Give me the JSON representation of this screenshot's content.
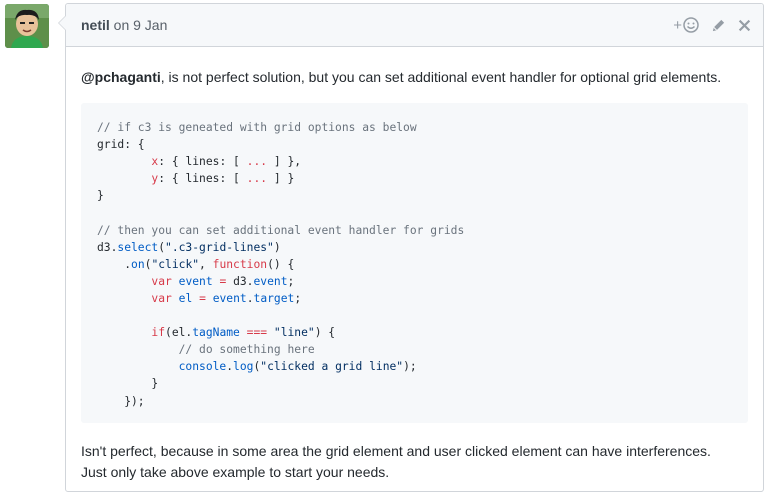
{
  "comment": {
    "author": "netil",
    "date_text": "on 9 Jan",
    "mention": "@pchaganti",
    "intro_text": ", is not perfect solution, but you can set additional event handler for optional grid elements.",
    "code_lines": [
      "// if c3 is geneated with grid options as below",
      "grid: {",
      "        x: { lines: [ ... ] },",
      "        y: { lines: [ ... ] }",
      "}",
      "",
      "// then you can set additional event handler for grids",
      "d3.select(\".c3-grid-lines\")",
      "    .on(\"click\", function() {",
      "        var event = d3.event;",
      "        var el = event.target;",
      "",
      "        if(el.tagName === \"line\") {",
      "            // do something here",
      "            console.log(\"clicked a grid line\");",
      "        }",
      "    });"
    ],
    "outro_line1": "Isn't perfect, because in some area the grid element and user clicked element can have interferences.",
    "outro_line2": "Just only take above example to start your needs."
  },
  "actions": {
    "reaction_icon": "add-reaction-icon",
    "reaction_label": "+",
    "edit_icon": "pencil-icon",
    "delete_icon": "close-icon"
  },
  "colors": {
    "header_bg": "#f6f8fa",
    "border": "#d1d5da",
    "code_bg": "#f6f8fa",
    "keyword": "#d73a49",
    "comment": "#6a737d",
    "function": "#005cc5"
  }
}
